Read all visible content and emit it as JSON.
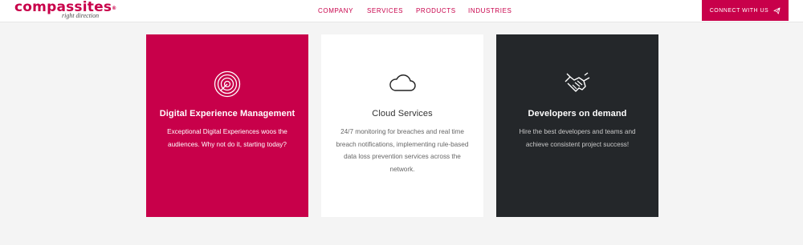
{
  "header": {
    "logo_text": "compassites",
    "logo_mark": "®",
    "logo_tagline": "right direction",
    "nav": [
      {
        "label": "COMPANY"
      },
      {
        "label": "SERVICES"
      },
      {
        "label": "PRODUCTS"
      },
      {
        "label": "INDUSTRIES"
      }
    ],
    "cta_label": "CONNECT WITH US",
    "cta_icon": "paper-plane-icon"
  },
  "cards": [
    {
      "icon": "target-icon",
      "title": "Digital Experience Management",
      "text": "Exceptional Digital Experiences woos the audiences. Why not do it, starting today?"
    },
    {
      "icon": "cloud-icon",
      "title": "Cloud Services",
      "text": "24/7 monitoring for breaches and real time breach notifications, implementing rule-based data loss prevention services across the network."
    },
    {
      "icon": "handshake-icon",
      "title": "Developers on demand",
      "text": "Hire the best developers and teams and achieve consistent project success!"
    }
  ],
  "colors": {
    "brand": "#c8004a",
    "dark_card": "#24272a",
    "page_bg": "#f4f4f4"
  }
}
